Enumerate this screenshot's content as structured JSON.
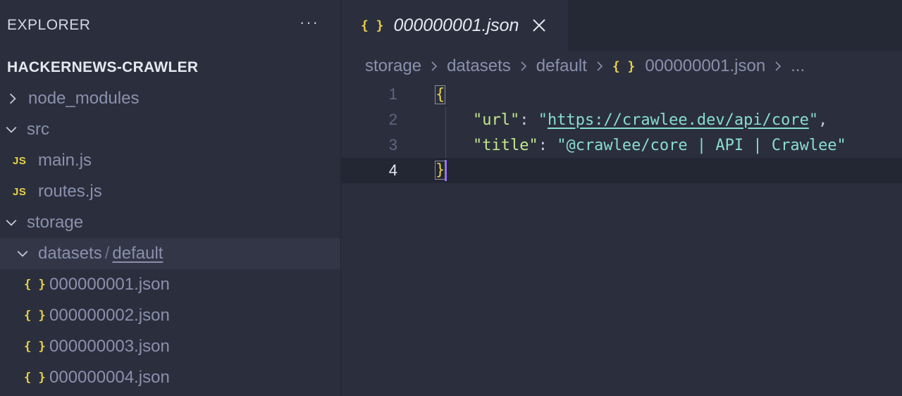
{
  "sidebar": {
    "title": "EXPLORER",
    "more_label": "···",
    "project": "HACKERNEWS-CRAWLER",
    "items": {
      "node_modules": "node_modules",
      "src": "src",
      "main_js": "main.js",
      "routes_js": "routes.js",
      "storage": "storage",
      "datasets": "datasets",
      "separator": "/",
      "default": "default",
      "file1": "000000001.json",
      "file2": "000000002.json",
      "file3": "000000003.json",
      "file4": "000000004.json"
    },
    "js_badge": "JS",
    "json_badge": "{ }"
  },
  "editor": {
    "tab": {
      "icon": "{ }",
      "label": "000000001.json"
    },
    "breadcrumb": {
      "storage": "storage",
      "datasets": "datasets",
      "default": "default",
      "icon": "{ }",
      "file": "000000001.json",
      "more": "..."
    },
    "line_numbers": [
      "1",
      "2",
      "3",
      "4"
    ],
    "code": {
      "open_brace": "{",
      "key_url": "\"url\"",
      "colon": ": ",
      "quote": "\"",
      "url_value": "https://crawlee.dev/api/core",
      "comma": ",",
      "key_title": "\"title\"",
      "title_value": "\"@crawlee/core | API | Crawlee\"",
      "close_brace": "}"
    }
  },
  "colors": {
    "background": "#2b2f3d",
    "accent_yellow": "#e8d14a",
    "string_green": "#c3e88d",
    "string_teal": "#89ddd1",
    "cursor_purple": "#9b6cff"
  }
}
